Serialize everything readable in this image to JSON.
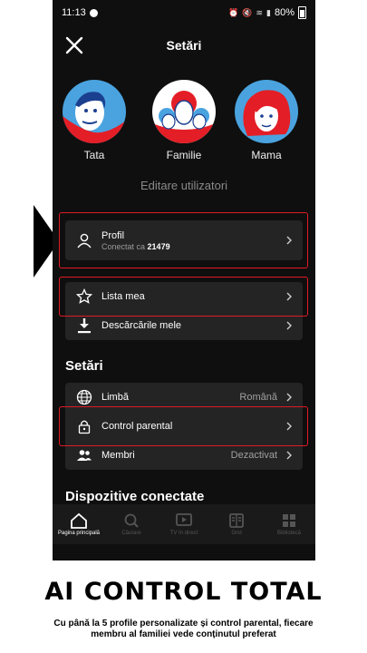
{
  "status_bar": {
    "time": "11:13",
    "battery": "80%"
  },
  "header": {
    "title": "Setări"
  },
  "profiles": [
    {
      "name": "Tata",
      "color": "#e41e26"
    },
    {
      "name": "Familie",
      "color": "#e41e26"
    },
    {
      "name": "Mama",
      "color": "#e41e26"
    }
  ],
  "edit_users_label": "Editare utilizatori",
  "account": {
    "profile_label": "Profil",
    "profile_sub_prefix": "Conectat ca",
    "profile_sub_value": "21479"
  },
  "my_list_label": "Lista mea",
  "downloads_label": "Descărcările mele",
  "settings_title": "Setări",
  "settings": {
    "language_label": "Limbă",
    "language_value": "Română",
    "parental_label": "Control parental",
    "members_label": "Membri",
    "members_value": "Dezactivat"
  },
  "devices_title": "Dispozitive conectate",
  "nav": {
    "home": "Pagina principală",
    "search": "Căutare",
    "live": "TV în direct",
    "grid": "Grid",
    "library": "Bibliotecă"
  },
  "headline": "AI CONTROL TOTAL",
  "subline": "Cu până la 5 profile personalizate și control parental, fiecare membru al familiei vede conținutul preferat",
  "colors": {
    "accent_red": "#e01b24",
    "avatar_blue": "#4aa3df",
    "background": "#0f0f0f"
  }
}
